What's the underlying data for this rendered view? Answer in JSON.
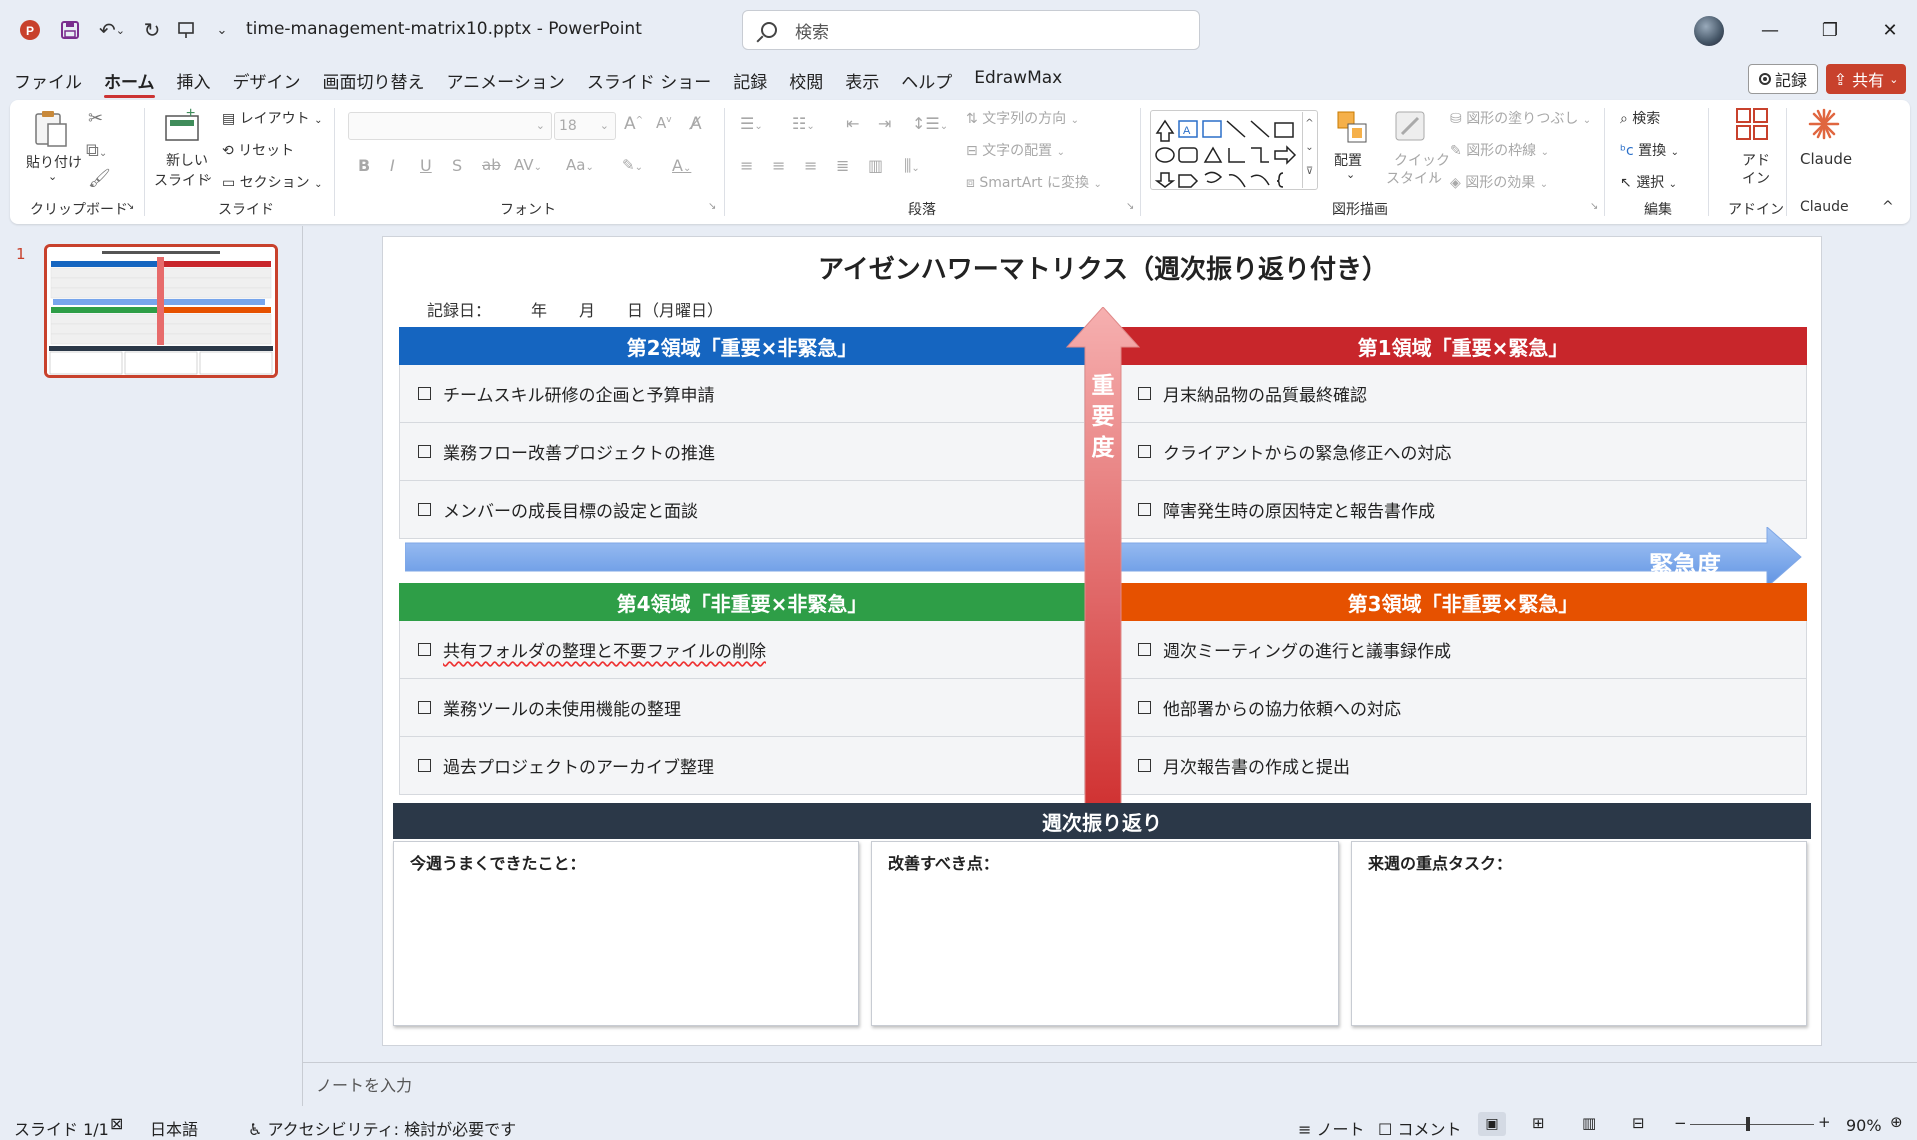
{
  "app": {
    "doc_title": "time-management-matrix10.pptx  -  PowerPoint",
    "search_placeholder": "検索"
  },
  "menu": {
    "tabs": [
      "ファイル",
      "ホーム",
      "挿入",
      "デザイン",
      "画面切り替え",
      "アニメーション",
      "スライド ショー",
      "記録",
      "校閲",
      "表示",
      "ヘルプ",
      "EdrawMax"
    ],
    "active": "ホーム",
    "record_label": "記録",
    "share_label": "共有"
  },
  "ribbon": {
    "clipboard": {
      "paste": "貼り付け",
      "label": "クリップボード"
    },
    "slides": {
      "new_slide_1": "新しい",
      "new_slide_2": "スライド",
      "layout": "レイアウト",
      "reset": "リセット",
      "section": "セクション",
      "label": "スライド"
    },
    "font": {
      "size": "18",
      "label": "フォント"
    },
    "paragraph": {
      "text_direction": "文字列の方向",
      "align_text": "文字の配置",
      "smartart": "SmartArt に変換",
      "label": "段落"
    },
    "drawing": {
      "arrange": "配置",
      "quick_style_1": "クイック",
      "quick_style_2": "スタイル",
      "fill": "図形の塗りつぶし",
      "outline": "図形の枠線",
      "effects": "図形の効果",
      "label": "図形描画"
    },
    "editing": {
      "find": "検索",
      "replace": "置換",
      "select": "選択",
      "label": "編集"
    },
    "addins": {
      "addin_1": "アド",
      "addin_2": "イン",
      "label": "アドイン"
    },
    "claude": {
      "button": "Claude",
      "label": "Claude"
    }
  },
  "thumbnail": {
    "number": "1"
  },
  "slide": {
    "title": "アイゼンハワーマトリクス（週次振り返り付き）",
    "record_date": "記録日：　　　年　　月　　日（月曜日）",
    "axis_importance": [
      "重",
      "要",
      "度"
    ],
    "axis_urgency": "緊急度",
    "colors": {
      "q1": "#c8262b",
      "q2": "#1565c0",
      "q3": "#e65100",
      "q4": "#2e9e47",
      "review": "#2b3848"
    },
    "q2": {
      "title": "第2領域「重要×非緊急」",
      "items": [
        "チームスキル研修の企画と予算申請",
        "業務フロー改善プロジェクトの推進",
        "メンバーの成長目標の設定と面談"
      ]
    },
    "q1": {
      "title": "第1領域「重要×緊急」",
      "items": [
        "月末納品物の品質最終確認",
        "クライアントからの緊急修正への対応",
        "障害発生時の原因特定と報告書作成"
      ]
    },
    "q4": {
      "title": "第4領域「非重要×非緊急」",
      "items": [
        "共有フォルダの整理と不要ファイルの削除",
        "業務ツールの未使用機能の整理",
        "過去プロジェクトのアーカイブ整理"
      ]
    },
    "q3": {
      "title": "第3領域「非重要×緊急」",
      "items": [
        "週次ミーティングの進行と議事録作成",
        "他部署からの協力依頼への対応",
        "月次報告書の作成と提出"
      ]
    },
    "review": {
      "title": "週次振り返り",
      "boxes": [
        "今週うまくできたこと：",
        "改善すべき点：",
        "来週の重点タスク："
      ]
    }
  },
  "notes_placeholder": "ノートを入力",
  "status": {
    "slide": "スライド 1/1",
    "language": "日本語",
    "accessibility": "アクセシビリティ: 検討が必要です",
    "notes": "ノート",
    "comments": "コメント",
    "zoom": "90%"
  }
}
